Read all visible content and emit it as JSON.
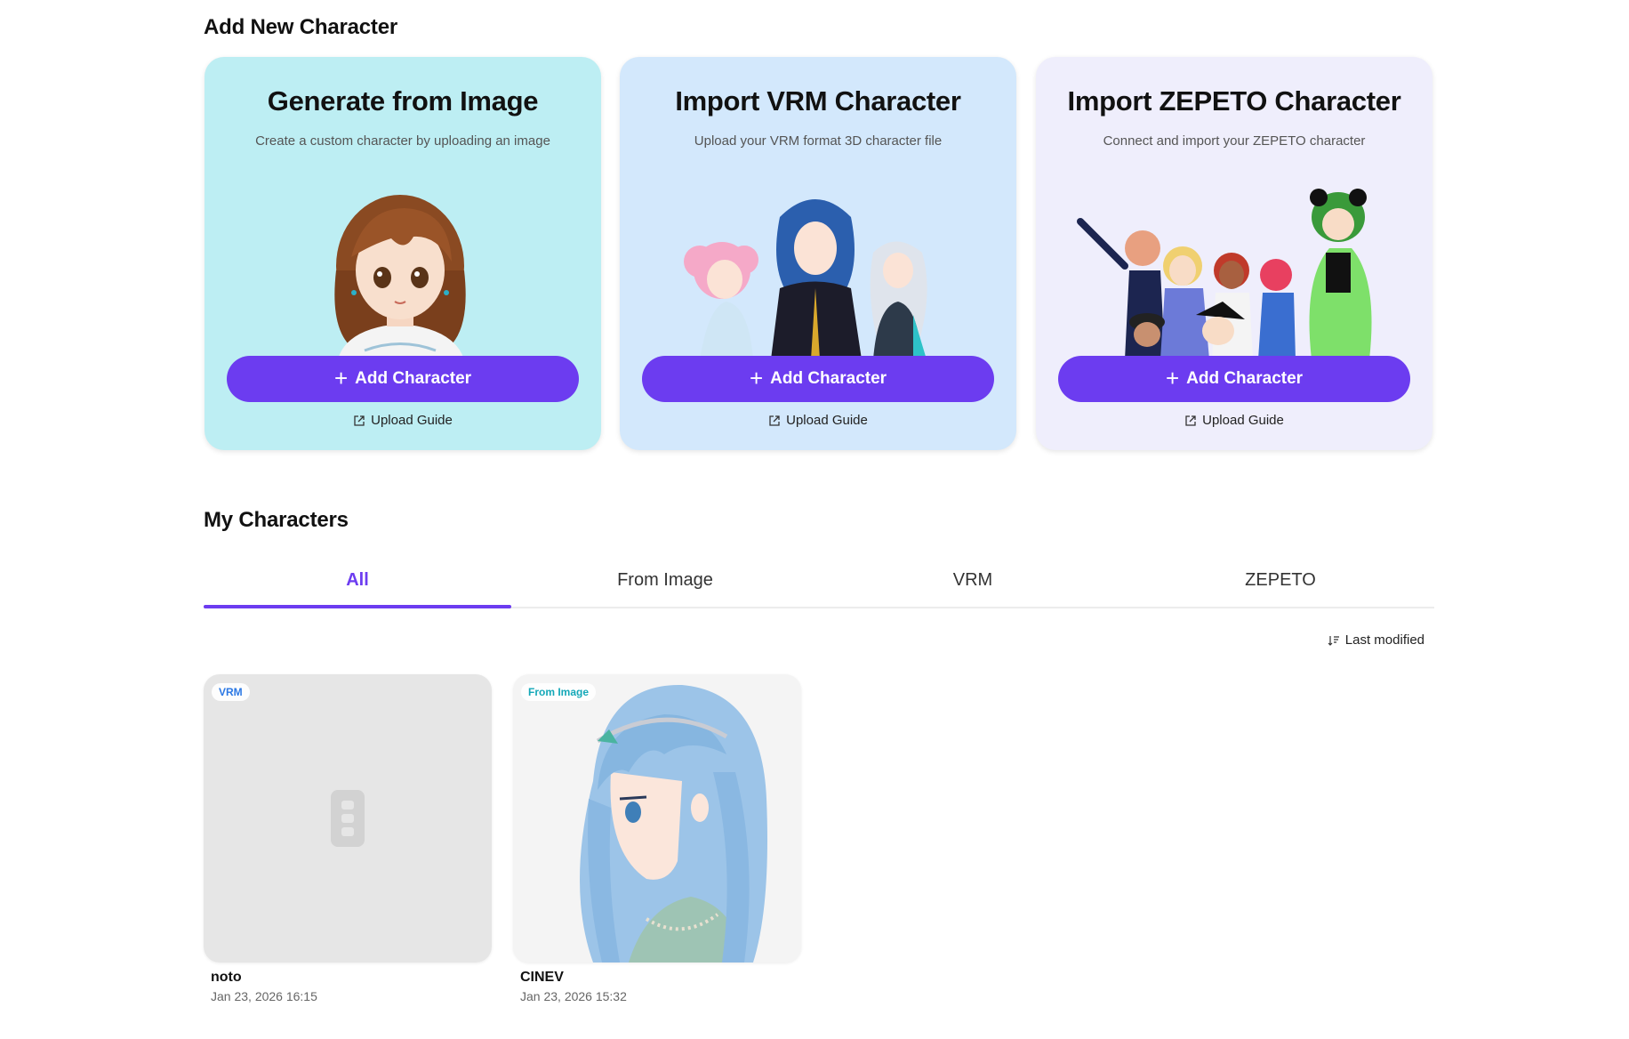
{
  "add_section": {
    "title": "Add New Character",
    "cards": [
      {
        "title": "Generate from Image",
        "subtitle": "Create a custom character by uploading an image",
        "button_label": "Add Character",
        "guide_label": "Upload Guide",
        "bg_color": "#bdeef3"
      },
      {
        "title": "Import VRM Character",
        "subtitle": "Upload your VRM format 3D character file",
        "button_label": "Add Character",
        "guide_label": "Upload Guide",
        "bg_color": "#d3e8fc"
      },
      {
        "title": "Import ZEPETO Character",
        "subtitle": "Connect and import your ZEPETO character",
        "button_label": "Add Character",
        "guide_label": "Upload Guide",
        "bg_color": "#efeefc"
      }
    ]
  },
  "my_section": {
    "title": "My Characters",
    "tabs": [
      {
        "label": "All",
        "active": true
      },
      {
        "label": "From Image",
        "active": false
      },
      {
        "label": "VRM",
        "active": false
      },
      {
        "label": "ZEPETO",
        "active": false
      }
    ],
    "sort_label": "Last modified",
    "characters": [
      {
        "badge": "VRM",
        "name": "noto",
        "date": "Jan 23, 2026 16:15"
      },
      {
        "badge": "From Image",
        "name": "CINEV",
        "date": "Jan 23, 2026 15:32"
      }
    ]
  },
  "colors": {
    "accent": "#6c3cf0",
    "vrm_badge": "#2b78e4",
    "image_badge": "#14a8b8"
  }
}
